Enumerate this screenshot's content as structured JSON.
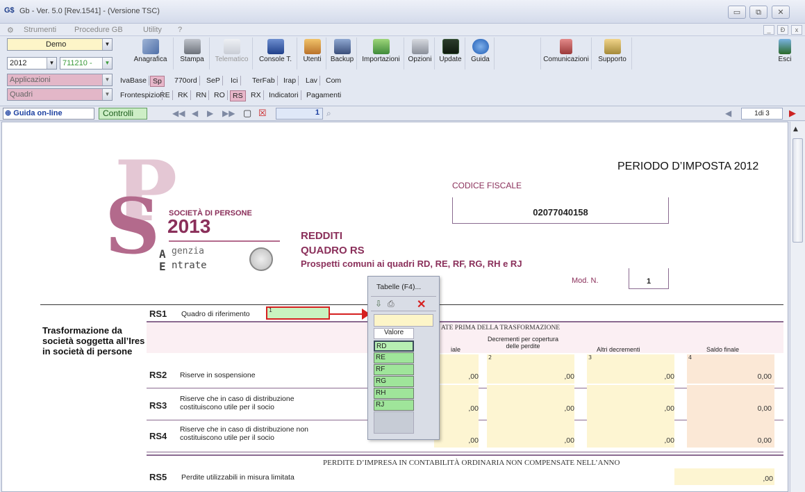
{
  "window": {
    "title": "Gb - Ver. 5.0 [Rev.1541] - (Versione TSC)",
    "app_icon": "G$"
  },
  "menu": {
    "items": [
      "Strumenti",
      "Procedure GB",
      "Utility",
      "?"
    ],
    "mdi_buttons": [
      "_",
      "Ɖ",
      "x"
    ]
  },
  "toolbar": {
    "user": "Demo",
    "year": "2012",
    "code": "711210 -",
    "applicazioni": "Applicazioni",
    "quadri": "Quadri",
    "buttons": [
      {
        "label": "Anagrafica",
        "icon": "address-book-icon"
      },
      {
        "label": "Stampa",
        "icon": "printer-icon"
      },
      {
        "label": "Telematico",
        "icon": "telematico-icon",
        "disabled": true
      },
      {
        "label": "Console T.",
        "icon": "console-icon"
      },
      {
        "label": "Utenti",
        "icon": "users-icon"
      },
      {
        "label": "Backup",
        "icon": "backup-icon"
      },
      {
        "label": "Importazioni",
        "icon": "import-icon"
      },
      {
        "label": "Opzioni",
        "icon": "options-icon"
      },
      {
        "label": "Update",
        "icon": "update-icon"
      },
      {
        "label": "Guida",
        "icon": "help-icon"
      },
      {
        "label": "Comunicazioni",
        "icon": "communications-icon"
      },
      {
        "label": "Supporto",
        "icon": "support-icon"
      },
      {
        "label": "Esci",
        "icon": "exit-icon"
      }
    ],
    "app_tabs": [
      "IvaBase",
      "Sp",
      "770ord",
      "SeP",
      "Ici",
      "TerFab",
      "Irap",
      "Lav",
      "Com"
    ],
    "quadri_tabs": [
      "Frontespizio",
      "RE",
      "RK",
      "RN",
      "RO",
      "RS",
      "RX",
      "Indicatori",
      "Pagamenti"
    ],
    "active_app_tab": "Sp",
    "active_quadro_tab": "RS"
  },
  "navbar": {
    "guida": "Guida on-line",
    "controlli": "Controlli",
    "page_field": "1",
    "page_info": "1di 3"
  },
  "form": {
    "periodo": "PERIODO D’IMPOSTA 2012",
    "codice_fiscale_label": "CODICE FISCALE",
    "codice_fiscale": "02077040158",
    "logo_line1": "SOCIETÀ DI PERSONE",
    "logo_year": "2013",
    "logo_agenzia": "genzia",
    "logo_entrate": "ntrate",
    "redditi": "REDDITI",
    "quadro": "QUADRO RS",
    "prospetti": "Prospetti comuni ai quadri RD, RE, RF, RG, RH e RJ",
    "mod_n_label": "Mod. N.",
    "mod_n": "1",
    "section_title": "Trasformazione da società soggetta all’Ires in società di persone",
    "rs1_code": "RS1",
    "rs1_label": "Quadro di riferimento",
    "rs1_field_num": "1",
    "header_main": "ATE PRIMA DELLA TRASFORMAZIONE",
    "col_iniziale": "iale",
    "col_decrementi": "Decrementi per copertura delle perdite",
    "col_altri": "Altri decrementi",
    "col_saldo": "Saldo finale",
    "col_nums": [
      "2",
      "3",
      "4"
    ],
    "rows": [
      {
        "code": "RS2",
        "label": "Riserve in sospensione",
        "values": [
          ",00",
          ",00",
          ",00",
          "0,00"
        ]
      },
      {
        "code": "RS3",
        "label": "Riserve che in caso di distribuzione costituiscono utile per il socio",
        "values": [
          ",00",
          ",00",
          ",00",
          "0,00"
        ]
      },
      {
        "code": "RS4",
        "label": "Riserve che in caso di distribuzione non costituiscono utile per il socio",
        "values": [
          ",00",
          ",00",
          ",00",
          "0,00"
        ]
      }
    ],
    "perdite_header": "PERDITE D’IMPRESA IN CONTABILITÀ ORDINARIA NON COMPENSATE NELL’ANNO",
    "rs5_code": "RS5",
    "rs5_label": "Perdite utilizzabili in misura limitata",
    "rs5_value": ",00"
  },
  "popup": {
    "title": "Tabelle (F4)...",
    "column": "Valore",
    "values": [
      "RD",
      "RE",
      "RF",
      "RG",
      "RH",
      "RJ"
    ],
    "selected": "RD"
  },
  "colors": {
    "accent": "#8a2f5a",
    "green": "#2e8b2e",
    "pink": "#e7b6c9"
  }
}
